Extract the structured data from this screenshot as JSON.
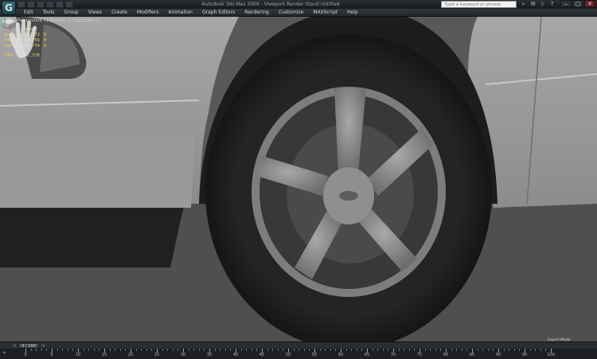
{
  "window": {
    "app_icon": "3ds-max-logo",
    "title": "Autodesk 3ds Max 2009   -  Viewport Render    Stand   Untitled",
    "search_placeholder": "Type a keyword or phrase",
    "minimize": "–",
    "maximize": "▢",
    "close": "✕"
  },
  "menu": [
    "Edit",
    "Tools",
    "Group",
    "Views",
    "Create",
    "Modifiers",
    "Animation",
    "Graph Editors",
    "Rendering",
    "Customize",
    "MAXScript",
    "Help"
  ],
  "viewport": {
    "label": "[ + ] [ Perspective ] [ Smooth + Highlights ]",
    "stats": {
      "header": "Total",
      "rows": [
        {
          "key": "Polys:",
          "value": "30,572",
          "extra": "0"
        },
        {
          "key": "Tris:",
          "value": "58,256",
          "extra": "0"
        },
        {
          "key": "Verts:",
          "value": "40,774",
          "extra": "0"
        }
      ],
      "fps_key": "FPS:",
      "fps_value": "82,376"
    },
    "watermark_text": "Expert Mode"
  },
  "timeslider": {
    "position_label": "0 / 100",
    "prev": "<",
    "next": ">"
  },
  "trackbar": {
    "icon": "⌖",
    "ticks": [
      "0",
      "5",
      "10",
      "15",
      "20",
      "25",
      "30",
      "35",
      "40",
      "45",
      "50",
      "55",
      "60",
      "65",
      "70",
      "75",
      "80",
      "85",
      "90",
      "95",
      "100"
    ]
  },
  "colors": {
    "stats_text": "#e9d25a",
    "viewport_bg": "#585858"
  }
}
